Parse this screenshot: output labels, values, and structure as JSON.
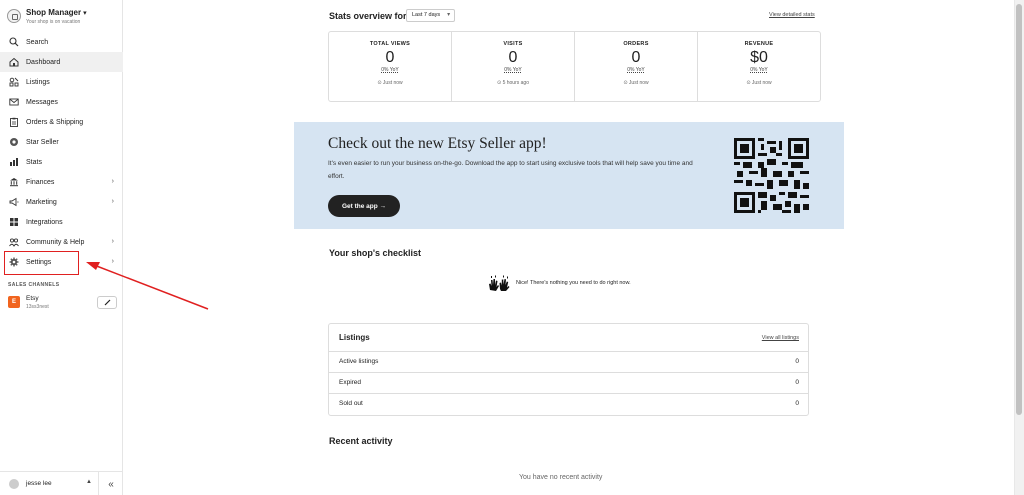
{
  "sidebar": {
    "shop_title": "Shop Manager",
    "shop_subtitle": "Your shop is on vacation",
    "items": [
      {
        "label": "Search",
        "icon": "search-icon"
      },
      {
        "label": "Dashboard",
        "icon": "home-icon",
        "active": true
      },
      {
        "label": "Listings",
        "icon": "listings-icon"
      },
      {
        "label": "Messages",
        "icon": "envelope-icon"
      },
      {
        "label": "Orders & Shipping",
        "icon": "clipboard-icon"
      },
      {
        "label": "Star Seller",
        "icon": "star-seller-icon"
      },
      {
        "label": "Stats",
        "icon": "bar-chart-icon"
      },
      {
        "label": "Finances",
        "icon": "bank-icon",
        "chevron": true
      },
      {
        "label": "Marketing",
        "icon": "megaphone-icon",
        "chevron": true
      },
      {
        "label": "Integrations",
        "icon": "grid-icon"
      },
      {
        "label": "Community & Help",
        "icon": "people-icon",
        "chevron": true
      },
      {
        "label": "Settings",
        "icon": "gear-icon",
        "chevron": true
      }
    ],
    "sales_channels_header": "SALES CHANNELS",
    "channel": {
      "badge": "E",
      "name": "Etsy",
      "shop": "13ss3nest"
    },
    "user_name": "jesse lee",
    "collapse_glyph": "«"
  },
  "stats": {
    "title": "Stats overview for",
    "range": "Last 7 days",
    "view_link": "View detailed stats",
    "cells": [
      {
        "label": "TOTAL VIEWS",
        "value": "0",
        "yoy": "0% YoY",
        "time": "⊙ Just now"
      },
      {
        "label": "VISITS",
        "value": "0",
        "yoy": "0% YoY",
        "time": "⊙ 5 hours ago"
      },
      {
        "label": "ORDERS",
        "value": "0",
        "yoy": "0% YoY",
        "time": "⊙ Just now"
      },
      {
        "label": "REVENUE",
        "value": "$0",
        "yoy": "0% YoY",
        "time": "⊙ Just now"
      }
    ]
  },
  "banner": {
    "title": "Check out the new Etsy Seller app!",
    "text": "It's even easier to run your business on-the-go. Download the app to start using exclusive tools that will help save you time and effort.",
    "button": "Get the app →",
    "background": "#d6e4f2"
  },
  "checklist": {
    "title": "Your shop's checklist",
    "message": "Nice! There's nothing you need to do right now."
  },
  "listings": {
    "title": "Listings",
    "view_link": "View all listings",
    "rows": [
      {
        "label": "Active listings",
        "count": "0"
      },
      {
        "label": "Expired",
        "count": "0"
      },
      {
        "label": "Sold out",
        "count": "0"
      }
    ]
  },
  "recent": {
    "title": "Recent activity",
    "empty": "You have no recent activity"
  },
  "colors": {
    "annotation_red": "#e02020",
    "etsy_orange": "#f1641e"
  }
}
